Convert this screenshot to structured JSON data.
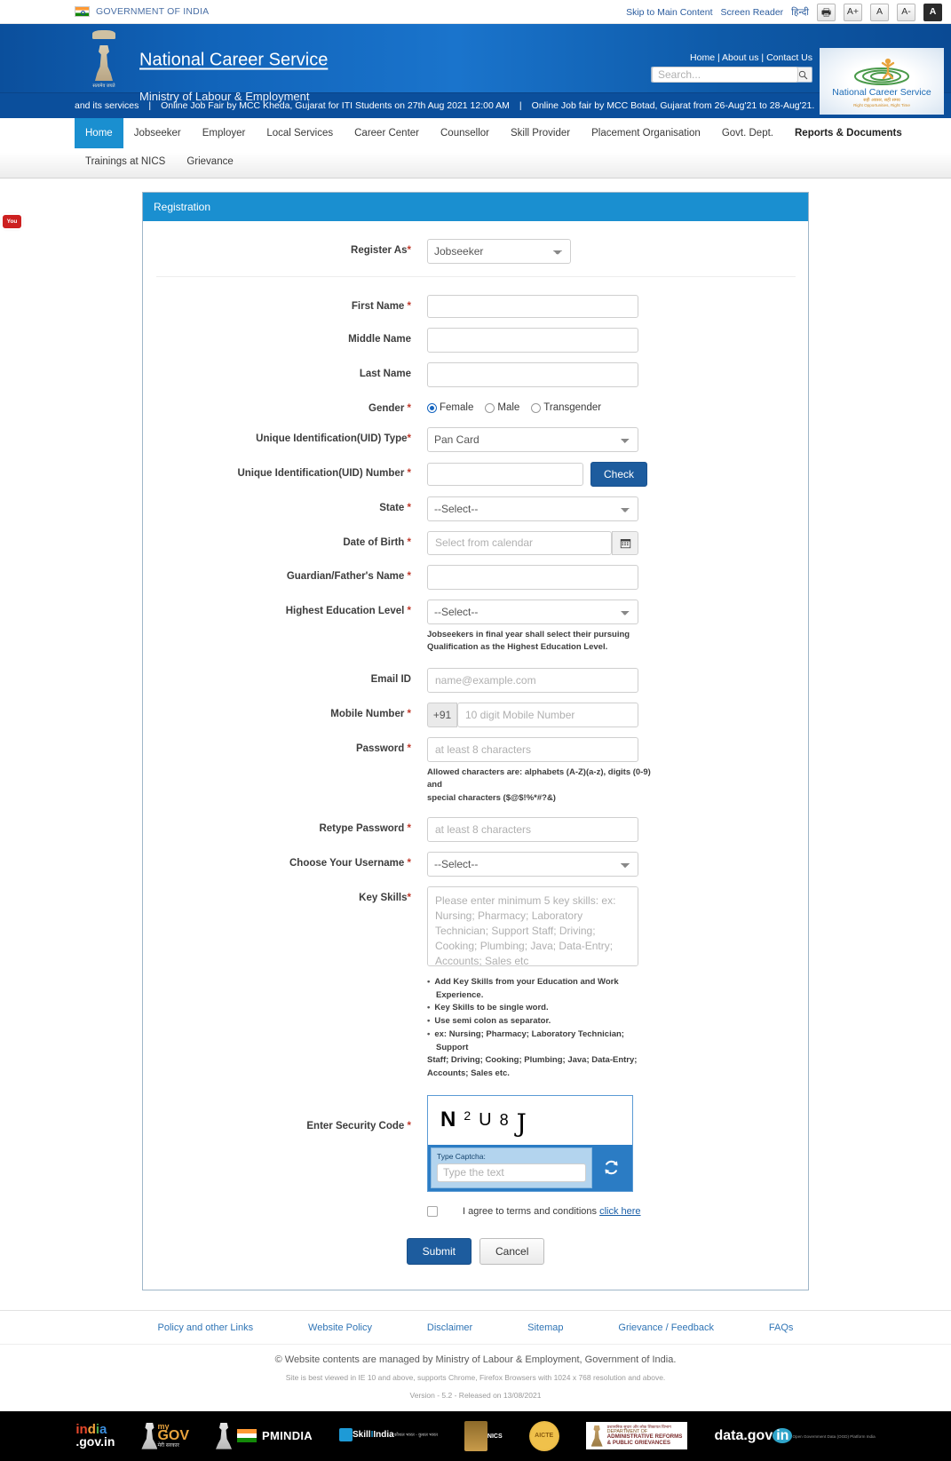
{
  "govbar": {
    "gov_label": "GOVERNMENT OF INDIA",
    "skip": "Skip to Main Content",
    "screen_reader": "Screen Reader",
    "hindi": "हिन्दी",
    "print_icon": "printer-icon",
    "font_increase": "A+",
    "font_normal": "A",
    "font_decrease": "A-",
    "contrast": "A"
  },
  "header": {
    "title": "National Career Service",
    "subtitle": "Ministry of Labour & Employment",
    "top_links": "Home | About us | Contact Us",
    "link_home": "Home",
    "link_about": "About us",
    "link_contact": "Contact Us",
    "search_placeholder": "Search...",
    "search_value": "",
    "emblem_motto": "सत्यमेव जयते",
    "logo_name": "National Career Service",
    "logo_tagline_hi": "सही अवसर, सही समय",
    "logo_tagline_en": "Right Opportunities, Right Time"
  },
  "ticker": {
    "part1": "and its services",
    "part2": "Online Job Fair by MCC Kheda, Gujarat for ITI Students on 27th Aug 2021 12:00 AM",
    "part3": "Online Job fair by MCC Botad, Gujarat from 26-Aug'21 to 28-Aug'21.",
    "separator": "|"
  },
  "nav": {
    "row1": [
      {
        "label": "Home",
        "active": true
      },
      {
        "label": "Jobseeker",
        "active": false
      },
      {
        "label": "Employer",
        "active": false
      },
      {
        "label": "Local Services",
        "active": false
      },
      {
        "label": "Career Center",
        "active": false
      },
      {
        "label": "Counsellor",
        "active": false
      },
      {
        "label": "Skill Provider",
        "active": false
      },
      {
        "label": "Placement Organisation",
        "active": false
      },
      {
        "label": "Govt. Dept.",
        "active": false
      },
      {
        "label": "Reports & Documents",
        "active": false
      }
    ],
    "row2": [
      {
        "label": "Trainings at NICS"
      },
      {
        "label": "Grievance"
      }
    ]
  },
  "side_tab": {
    "youtube": "You"
  },
  "panel": {
    "title": "Registration"
  },
  "form": {
    "register_as": {
      "label": "Register As",
      "required": true,
      "value": "Jobseeker"
    },
    "first_name": {
      "label": "First Name",
      "required": true,
      "value": "",
      "placeholder": ""
    },
    "middle_name": {
      "label": "Middle Name",
      "required": false,
      "value": "",
      "placeholder": ""
    },
    "last_name": {
      "label": "Last Name",
      "required": false,
      "value": "",
      "placeholder": ""
    },
    "gender": {
      "label": "Gender",
      "required": true,
      "selected": "Female",
      "options": [
        "Female",
        "Male",
        "Transgender"
      ]
    },
    "uid_type": {
      "label": "Unique Identification(UID) Type",
      "required": true,
      "value": "Pan Card"
    },
    "uid_number": {
      "label": "Unique Identification(UID) Number",
      "required": true,
      "value": "",
      "placeholder": "",
      "check_button": "Check"
    },
    "state": {
      "label": "State",
      "required": true,
      "value": "--Select--"
    },
    "dob": {
      "label": "Date of Birth",
      "required": true,
      "value": "",
      "placeholder": "Select from calendar",
      "icon": "calendar-icon"
    },
    "guardian": {
      "label": "Guardian/Father's Name",
      "required": true,
      "value": "",
      "placeholder": ""
    },
    "education": {
      "label": "Highest Education Level",
      "required": true,
      "value": "--Select--",
      "hint_line1": "Jobseekers in final year shall select their pursuing",
      "hint_line2": "Qualification as the Highest Education Level."
    },
    "email": {
      "label": "Email ID",
      "required": false,
      "value": "",
      "placeholder": "name@example.com"
    },
    "mobile": {
      "label": "Mobile Number",
      "required": true,
      "country_code": "+91",
      "value": "",
      "placeholder": "10 digit Mobile Number"
    },
    "password": {
      "label": "Password",
      "required": true,
      "value": "",
      "placeholder": "at least 8 characters",
      "hint_line1": "Allowed characters are: alphabets (A-Z)(a-z), digits (0-9) and",
      "hint_line2": "special characters ($@$!%*#?&)"
    },
    "retype_password": {
      "label": "Retype Password",
      "required": true,
      "value": "",
      "placeholder": "at least 8 characters"
    },
    "username": {
      "label": "Choose Your Username",
      "required": true,
      "value": "--Select--"
    },
    "key_skills": {
      "label": "Key Skills",
      "required": true,
      "value": "",
      "placeholder": "Please enter minimum 5 key skills: ex: Nursing; Pharmacy; Laboratory Technician; Support Staff; Driving; Cooking; Plumbing; Java; Data-Entry; Accounts; Sales etc",
      "bullets": [
        "Add Key Skills from your Education and Work Experience.",
        "Key Skills to be single word.",
        "Use semi colon as separator.",
        "ex: Nursing; Pharmacy; Laboratory Technician; Support"
      ],
      "bullet_continuation1": "Staff; Driving; Cooking; Plumbing; Java; Data-Entry;",
      "bullet_continuation2": "Accounts; Sales etc."
    },
    "security_code": {
      "label": "Enter Security Code",
      "required": true,
      "captcha_chars": [
        "N",
        "2",
        "U",
        "8",
        "J"
      ],
      "captcha_text": "N2U8J",
      "type_label": "Type Captcha:",
      "input_placeholder": "Type the text",
      "input_value": "",
      "refresh_icon": "refresh-icon"
    },
    "terms": {
      "checked": false,
      "text": "I agree to terms and conditions",
      "link_text": "click here"
    },
    "submit_label": "Submit",
    "cancel_label": "Cancel"
  },
  "footer": {
    "links": [
      "Policy and other Links",
      "Website Policy",
      "Disclaimer",
      "Sitemap",
      "Grievance / Feedback",
      "FAQs"
    ],
    "copyright": "© Website contents are managed by Ministry of Labour & Employment, Government of India.",
    "browser_note": "Site is best viewed in IE 10 and above, supports Chrome, Firefox Browsers with 1024 x 768 resolution and above.",
    "version": "Version - 5.2 - Released on 13/08/2021"
  },
  "logos": {
    "india": {
      "l1": "in",
      "l2": "d",
      "l3": "i",
      "l4": "a",
      "sub": ".gov.in"
    },
    "mygov": {
      "m1": "my",
      "m2": "GOV",
      "m3": "मेरी सरकार"
    },
    "pmindia": "PMINDIA",
    "skillindia": {
      "s1a": "Skill",
      "s1b": "I",
      "s1c": "India",
      "s2": "कौशल भारत - कुशल भारत"
    },
    "nics": "NICS",
    "aicte": "AICTE",
    "darpg": {
      "d0": "प्रशासनिक सुधार और लोक शिकायत विभाग",
      "d1": "DEPARTMENT OF",
      "d2": "ADMINISTRATIVE REFORMS",
      "d3": "& PUBLIC GRIEVANCES"
    },
    "datagov": {
      "main": "data.gov",
      "circle": "in",
      "sub": "Open Government Data (OGD) Platform India"
    }
  },
  "colors": {
    "header_blue": "#0b4f9c",
    "panel_blue": "#1a8fd0",
    "button_blue": "#1d5c9e",
    "link_blue": "#2f74b5",
    "required_red": "#c0392b"
  }
}
